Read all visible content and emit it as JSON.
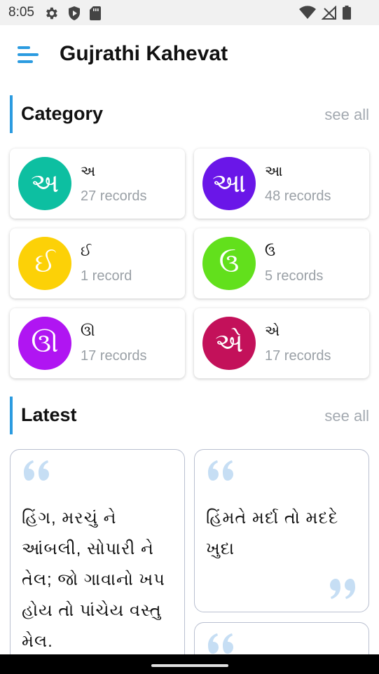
{
  "status_bar": {
    "time": "8:05",
    "left_icons": [
      "settings-icon",
      "shield-icon",
      "sd-card-icon"
    ],
    "right_icons": [
      "wifi-icon",
      "signal-icon",
      "battery-icon"
    ]
  },
  "app_bar": {
    "title": "Gujrathi Kahevat",
    "menu_icon": "menu-icon",
    "accent_color": "#2b9be0"
  },
  "category_section": {
    "title": "Category",
    "see_all": "see all",
    "items": [
      {
        "letter": "અ",
        "name": "અ",
        "count": "27 records",
        "color": "#0dbfa1"
      },
      {
        "letter": "આ",
        "name": "આ",
        "count": "48 records",
        "color": "#6a16e8"
      },
      {
        "letter": "ઈ",
        "name": "ઈ",
        "count": "1 record",
        "color": "#fcd107"
      },
      {
        "letter": "ઉ",
        "name": "ઉ",
        "count": "5 records",
        "color": "#62e01c"
      },
      {
        "letter": "ઊ",
        "name": "ઊ",
        "count": "17 records",
        "color": "#b015f2"
      },
      {
        "letter": "એ",
        "name": "એ",
        "count": "17 records",
        "color": "#c3115a"
      }
    ]
  },
  "latest_section": {
    "title": "Latest",
    "see_all": "see all",
    "quotes": [
      {
        "text": "હિંગ, મરચું ને આંબલી, સોપારી ને તેલ; જો ગાવાનો ખપ હોય તો પાંચેય વસ્તુ મેલ."
      },
      {
        "text": "હિંમતે મર્દા તો મદદે ખુદા"
      },
      {
        "text": ""
      }
    ],
    "quote_mark_color": "#c6def4"
  }
}
